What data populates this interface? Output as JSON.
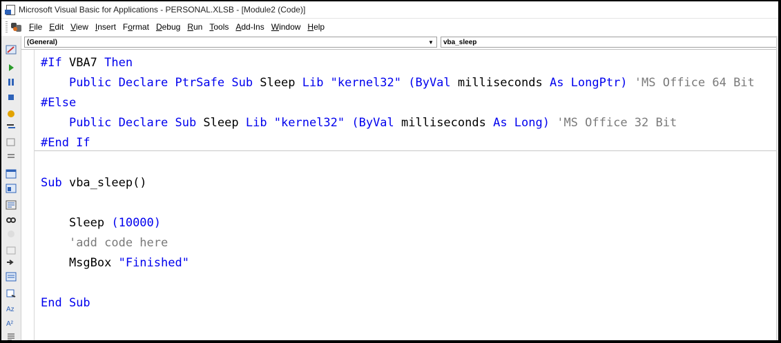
{
  "window": {
    "title": "Microsoft Visual Basic for Applications - PERSONAL.XLSB - [Module2 (Code)]"
  },
  "menu": [
    {
      "acc": "F",
      "rest": "ile"
    },
    {
      "acc": "E",
      "rest": "dit"
    },
    {
      "acc": "V",
      "rest": "iew"
    },
    {
      "acc": "I",
      "rest": "nsert"
    },
    {
      "pre": "F",
      "acc": "o",
      "rest": "rmat"
    },
    {
      "acc": "D",
      "rest": "ebug"
    },
    {
      "acc": "R",
      "rest": "un"
    },
    {
      "acc": "T",
      "rest": "ools"
    },
    {
      "acc": "A",
      "rest": "dd-Ins"
    },
    {
      "acc": "W",
      "rest": "indow"
    },
    {
      "acc": "H",
      "rest": "elp"
    }
  ],
  "object_combo": {
    "value": "(General)"
  },
  "procedure_combo": {
    "value": "vba_sleep"
  },
  "toolbar_icons": [
    "design-mode-icon",
    "run-icon",
    "break-icon",
    "reset-icon",
    "toggle-breakpoint-icon",
    "step-into-icon",
    "step-over-icon",
    "step-out-icon",
    "properties-icon",
    "object-browser-icon",
    "project-explorer-icon",
    "watch-icon",
    "quick-watch-icon",
    "immediate-icon",
    "toolbox-icon",
    "list-properties-icon",
    "complete-word-icon",
    "indent-icon",
    "outdent-icon",
    "comment-block-icon"
  ],
  "code_lines": [
    [
      {
        "t": "kw",
        "v": "#If "
      },
      {
        "t": "id",
        "v": "VBA7 "
      },
      {
        "t": "kw",
        "v": "Then"
      }
    ],
    [
      {
        "t": "id",
        "v": "    "
      },
      {
        "t": "kw",
        "v": "Public Declare PtrSafe Sub "
      },
      {
        "t": "id",
        "v": "Sleep "
      },
      {
        "t": "kw",
        "v": "Lib \"kernel32\" (ByVal "
      },
      {
        "t": "id",
        "v": "milliseconds "
      },
      {
        "t": "kw",
        "v": "As LongPtr) "
      },
      {
        "t": "cm",
        "v": "'MS Office 64 Bit"
      }
    ],
    [
      {
        "t": "kw",
        "v": "#Else"
      }
    ],
    [
      {
        "t": "id",
        "v": "    "
      },
      {
        "t": "kw",
        "v": "Public Declare Sub "
      },
      {
        "t": "id",
        "v": "Sleep "
      },
      {
        "t": "kw",
        "v": "Lib \"kernel32\" (ByVal "
      },
      {
        "t": "id",
        "v": "milliseconds "
      },
      {
        "t": "kw",
        "v": "As Long) "
      },
      {
        "t": "cm",
        "v": "'MS Office 32 Bit"
      }
    ],
    [
      {
        "t": "kw",
        "v": "#End If"
      }
    ],
    [],
    [
      {
        "t": "kw",
        "v": "Sub "
      },
      {
        "t": "id",
        "v": "vba_sleep()"
      }
    ],
    [],
    [
      {
        "t": "id",
        "v": "    Sleep "
      },
      {
        "t": "kw",
        "v": "(10000)"
      }
    ],
    [
      {
        "t": "id",
        "v": "    "
      },
      {
        "t": "cm",
        "v": "'add code here"
      }
    ],
    [
      {
        "t": "id",
        "v": "    MsgBox "
      },
      {
        "t": "kw",
        "v": "\"Finished\""
      }
    ],
    [],
    [
      {
        "t": "kw",
        "v": "End Sub"
      }
    ]
  ],
  "colors": {
    "keyword": "#0000ee",
    "comment": "#7a7a7a",
    "identifier": "#000000"
  }
}
